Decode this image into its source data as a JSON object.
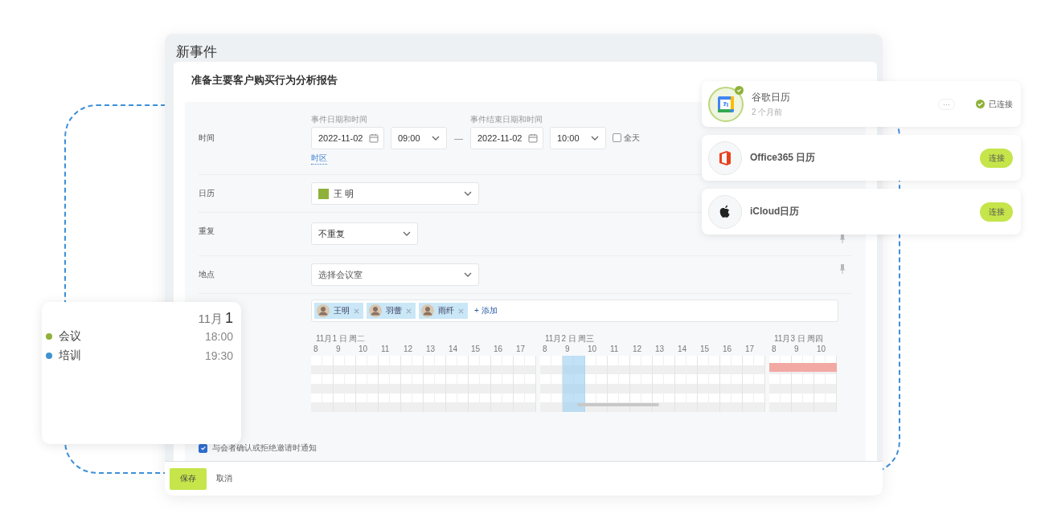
{
  "window": {
    "title": "新事件"
  },
  "event": {
    "title": "准备主要客户购买行为分析报告"
  },
  "time": {
    "label": "时间",
    "start_label": "事件日期和时间",
    "start_date": "2022-11-02",
    "start_time": "09:00",
    "separator": "—",
    "end_label": "事件结束日期和时间",
    "end_date": "2022-11-02",
    "end_time": "10:00",
    "all_day": {
      "label": "全天",
      "checked": false
    },
    "timezone_link": "时区"
  },
  "calendar": {
    "label": "日历",
    "value": "王 明",
    "color": "#8fb13a"
  },
  "repeat": {
    "label": "重复",
    "value": "不重复"
  },
  "location": {
    "label": "地点",
    "placeholder": "选择会议室"
  },
  "attendees": [
    {
      "name": "王明"
    },
    {
      "name": "羽蕾"
    },
    {
      "name": "雨纤"
    }
  ],
  "add_attendee": "+ 添加",
  "schedule": {
    "days": [
      {
        "label": "11月1 日 周二",
        "busy": false,
        "hours": [
          {
            "label": "8",
            "selected": false
          },
          {
            "label": "9",
            "selected": false
          },
          {
            "label": "10",
            "selected": false
          },
          {
            "label": "11",
            "selected": false
          },
          {
            "label": "12",
            "selected": false
          },
          {
            "label": "13",
            "selected": false
          },
          {
            "label": "14",
            "selected": false
          },
          {
            "label": "15",
            "selected": false
          },
          {
            "label": "16",
            "selected": false
          },
          {
            "label": "17",
            "selected": false
          }
        ]
      },
      {
        "label": "11月2 日 周三",
        "busy": false,
        "hours": [
          {
            "label": "8",
            "selected": false
          },
          {
            "label": "9",
            "selected": true
          },
          {
            "label": "10",
            "selected": false
          },
          {
            "label": "11",
            "selected": false
          },
          {
            "label": "12",
            "selected": false
          },
          {
            "label": "13",
            "selected": false
          },
          {
            "label": "14",
            "selected": false
          },
          {
            "label": "15",
            "selected": false
          },
          {
            "label": "16",
            "selected": false
          },
          {
            "label": "17",
            "selected": false
          }
        ]
      },
      {
        "label": "11月3 日 周四",
        "busy": true,
        "hours": [
          {
            "label": "8",
            "selected": false
          },
          {
            "label": "9",
            "selected": false
          },
          {
            "label": "10",
            "selected": false
          }
        ]
      }
    ]
  },
  "notify": {
    "label": "与会者确认或拒绝邀请时通知",
    "checked": true
  },
  "buttons": {
    "save": "保存",
    "cancel": "取消"
  },
  "integrations": [
    {
      "kind": "google",
      "name": "谷歌日历",
      "subtitle": "2 个月前",
      "connected": true,
      "more": "···",
      "status": "已连接"
    },
    {
      "kind": "office",
      "name": "Office365 日历",
      "connected": false,
      "action": "连接"
    },
    {
      "kind": "apple",
      "name": "iCloud日历",
      "connected": false,
      "action": "连接"
    }
  ],
  "agenda": {
    "month": "11月",
    "day": "1",
    "events": [
      {
        "name": "会议",
        "time": "18:00",
        "color": "#8fb13a"
      },
      {
        "name": "培训",
        "time": "19:30",
        "color": "#3d93d1"
      }
    ]
  }
}
